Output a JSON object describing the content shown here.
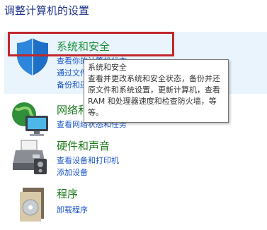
{
  "page": {
    "title": "调整计算机的设置"
  },
  "categories": [
    {
      "title": "系统和安全",
      "links": [
        "查看你的计算机状态",
        "通过文件历史记录保存你的文件备份副本",
        "备份和还原(Windows 7)"
      ],
      "icon": "shield-icon"
    },
    {
      "title": "网络和 Internet",
      "links": [
        "查看网络状态和任务"
      ],
      "icon": "network-icon"
    },
    {
      "title": "硬件和声音",
      "links": [
        "查看设备和打印机",
        "添加设备"
      ],
      "icon": "printer-icon"
    },
    {
      "title": "程序",
      "links": [
        "卸载程序"
      ],
      "icon": "programs-icon"
    }
  ],
  "tooltip": {
    "title": "系统和安全",
    "body": "查看并更改系统和安全状态，备份并还原文件和系统设置，更新计算机，查看 RAM 和处理器速度和检查防火墙，等等。"
  },
  "colors": {
    "title": "#1e3287",
    "category": "#1c7a1c",
    "link": "#1a55c8",
    "highlight": "#c1272d",
    "hover_bg": "#eaf4fc"
  }
}
